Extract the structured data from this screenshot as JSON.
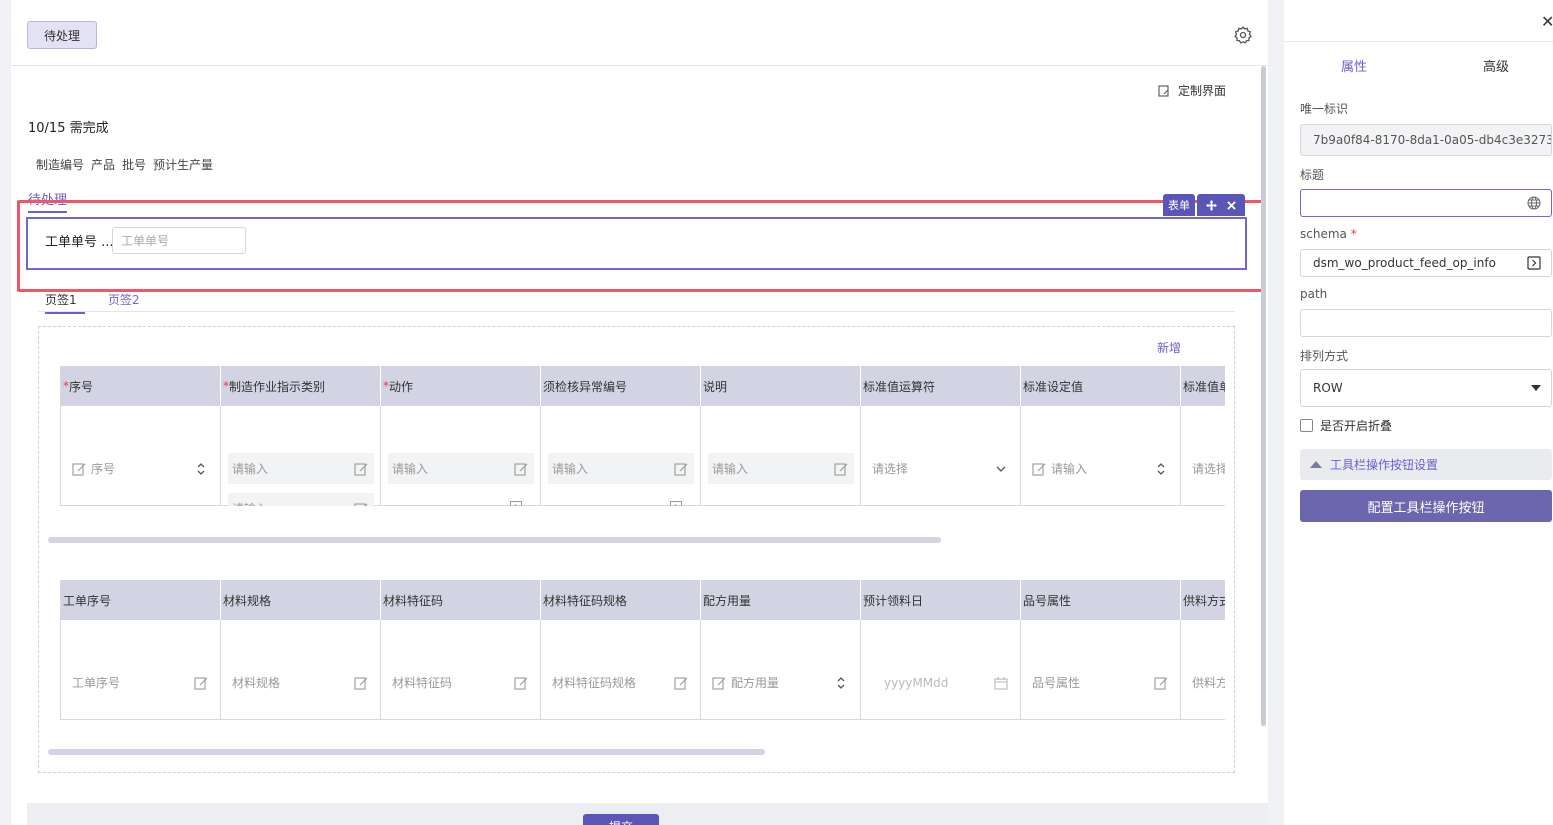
{
  "header": {
    "status_button": "待处理"
  },
  "toolbar": {
    "customize_label": "定制界面"
  },
  "summary": {
    "due_text": "10/15 需完成",
    "fields": [
      "制造编号",
      "产品",
      "批号",
      "预计生产量"
    ]
  },
  "tabs": {
    "active": "待处理"
  },
  "selection": {
    "form_badge": "表单"
  },
  "form": {
    "work_order_label": "工单单号 ...",
    "work_order_placeholder": "工单单号"
  },
  "subtabs": [
    "页签1",
    "页签2"
  ],
  "table_actions": {
    "add_label": "新增"
  },
  "table1": {
    "columns": [
      {
        "label": "序号",
        "required": "*"
      },
      {
        "label": "制造作业指示类别",
        "required": "*"
      },
      {
        "label": "动作",
        "required": "*"
      },
      {
        "label": "须检核异常编号",
        "required": ""
      },
      {
        "label": "说明",
        "required": ""
      },
      {
        "label": "标准值运算符",
        "required": ""
      },
      {
        "label": "标准设定值",
        "required": ""
      },
      {
        "label": "标准值单位",
        "required": ""
      }
    ],
    "cells": {
      "seq_placeholder": "序号",
      "input_placeholder": "请输入",
      "select_placeholder": "请选择"
    }
  },
  "table2": {
    "columns": [
      "工单序号",
      "材料规格",
      "材料特征码",
      "材料特征码规格",
      "配方用量",
      "预计领料日",
      "品号属性",
      "供料方式"
    ],
    "placeholders": [
      "工单序号",
      "材料规格",
      "材料特征码",
      "材料特征码规格",
      "配方用量",
      "yyyyMMdd",
      "品号属性",
      "供料方"
    ]
  },
  "footer": {
    "submit_label": "提交"
  },
  "panel": {
    "tabs": {
      "properties": "属性",
      "advanced": "高级"
    },
    "unique_id_label": "唯一标识",
    "unique_id_value": "7b9a0f84-8170-8da1-0a05-db4c3e3273",
    "title_label": "标题",
    "title_value": "",
    "schema_label": "schema",
    "schema_required": "*",
    "schema_value": "dsm_wo_product_feed_op_info",
    "path_label": "path",
    "path_value": "",
    "layout_label": "排列方式",
    "layout_value": "ROW",
    "collapse_label": "是否开启折叠",
    "toolbar_section_label": "工具栏操作按钮设置",
    "config_button_label": "配置工具栏操作按钮"
  },
  "colors": {
    "accent": "#6a5fd0",
    "highlight": "#ef5666",
    "header_bg": "#d2d4e4"
  }
}
